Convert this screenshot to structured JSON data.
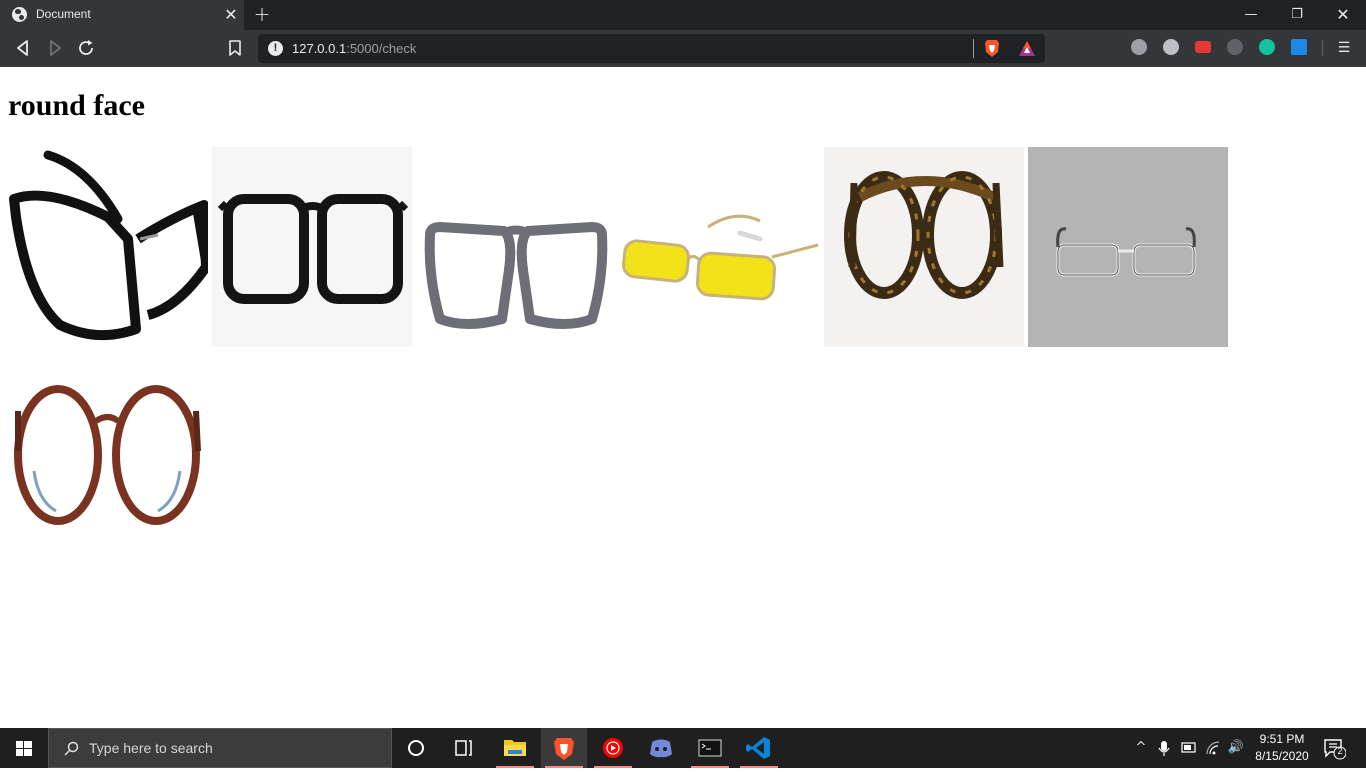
{
  "browser": {
    "tab": {
      "title": "Document",
      "favicon": "globe-icon",
      "close_glyph": "✕"
    },
    "new_tab_glyph": "+",
    "window_controls": {
      "minimize": "—",
      "restore": "❐",
      "close": "✕"
    },
    "address": {
      "host": "127.0.0.1",
      "path": ":5000/check",
      "security_icon": "info-icon",
      "info_glyph": "!"
    },
    "extensions": [
      "power-icon",
      "gorilla-icon",
      "youtube-icon",
      "owl-icon",
      "grammarly-icon",
      "download-icon"
    ],
    "menu_glyph": "☰"
  },
  "page": {
    "heading": "round face",
    "frames": [
      {
        "label": "black rectangular frame, angled view",
        "colors": {
          "frame": "#111111",
          "bg": "#ffffff"
        }
      },
      {
        "label": "black square frame",
        "colors": {
          "frame": "#141414",
          "bg": "#f6f6f6"
        }
      },
      {
        "label": "grey square frame",
        "colors": {
          "frame": "#6d6e76",
          "bg": "#ffffff"
        }
      },
      {
        "label": "gold frame with yellow lenses",
        "colors": {
          "frame": "#c7b27a",
          "lens": "#f2e21a",
          "bg": "#ffffff"
        }
      },
      {
        "label": "tortoiseshell frame",
        "colors": {
          "frame": "#3b2a14",
          "bg": "#f4f2f0"
        }
      },
      {
        "label": "silver rimless rectangular frame",
        "colors": {
          "frame": "#e8e8e8",
          "bg": "#b4b4b4"
        }
      },
      {
        "label": "brown round frame",
        "colors": {
          "frame": "#7a3320",
          "bg": "#ffffff"
        }
      }
    ]
  },
  "taskbar": {
    "search_placeholder": "Type here to search",
    "apps": [
      "cortana-icon",
      "task-view-icon",
      "file-explorer-icon",
      "brave-icon",
      "youtube-music-icon",
      "discord-icon",
      "terminal-icon",
      "vscode-icon"
    ],
    "time": "9:51 PM",
    "date": "8/15/2020",
    "notification_count": "2",
    "tray_glyphs": {
      "chevron": "^",
      "volume": "🔊"
    }
  }
}
